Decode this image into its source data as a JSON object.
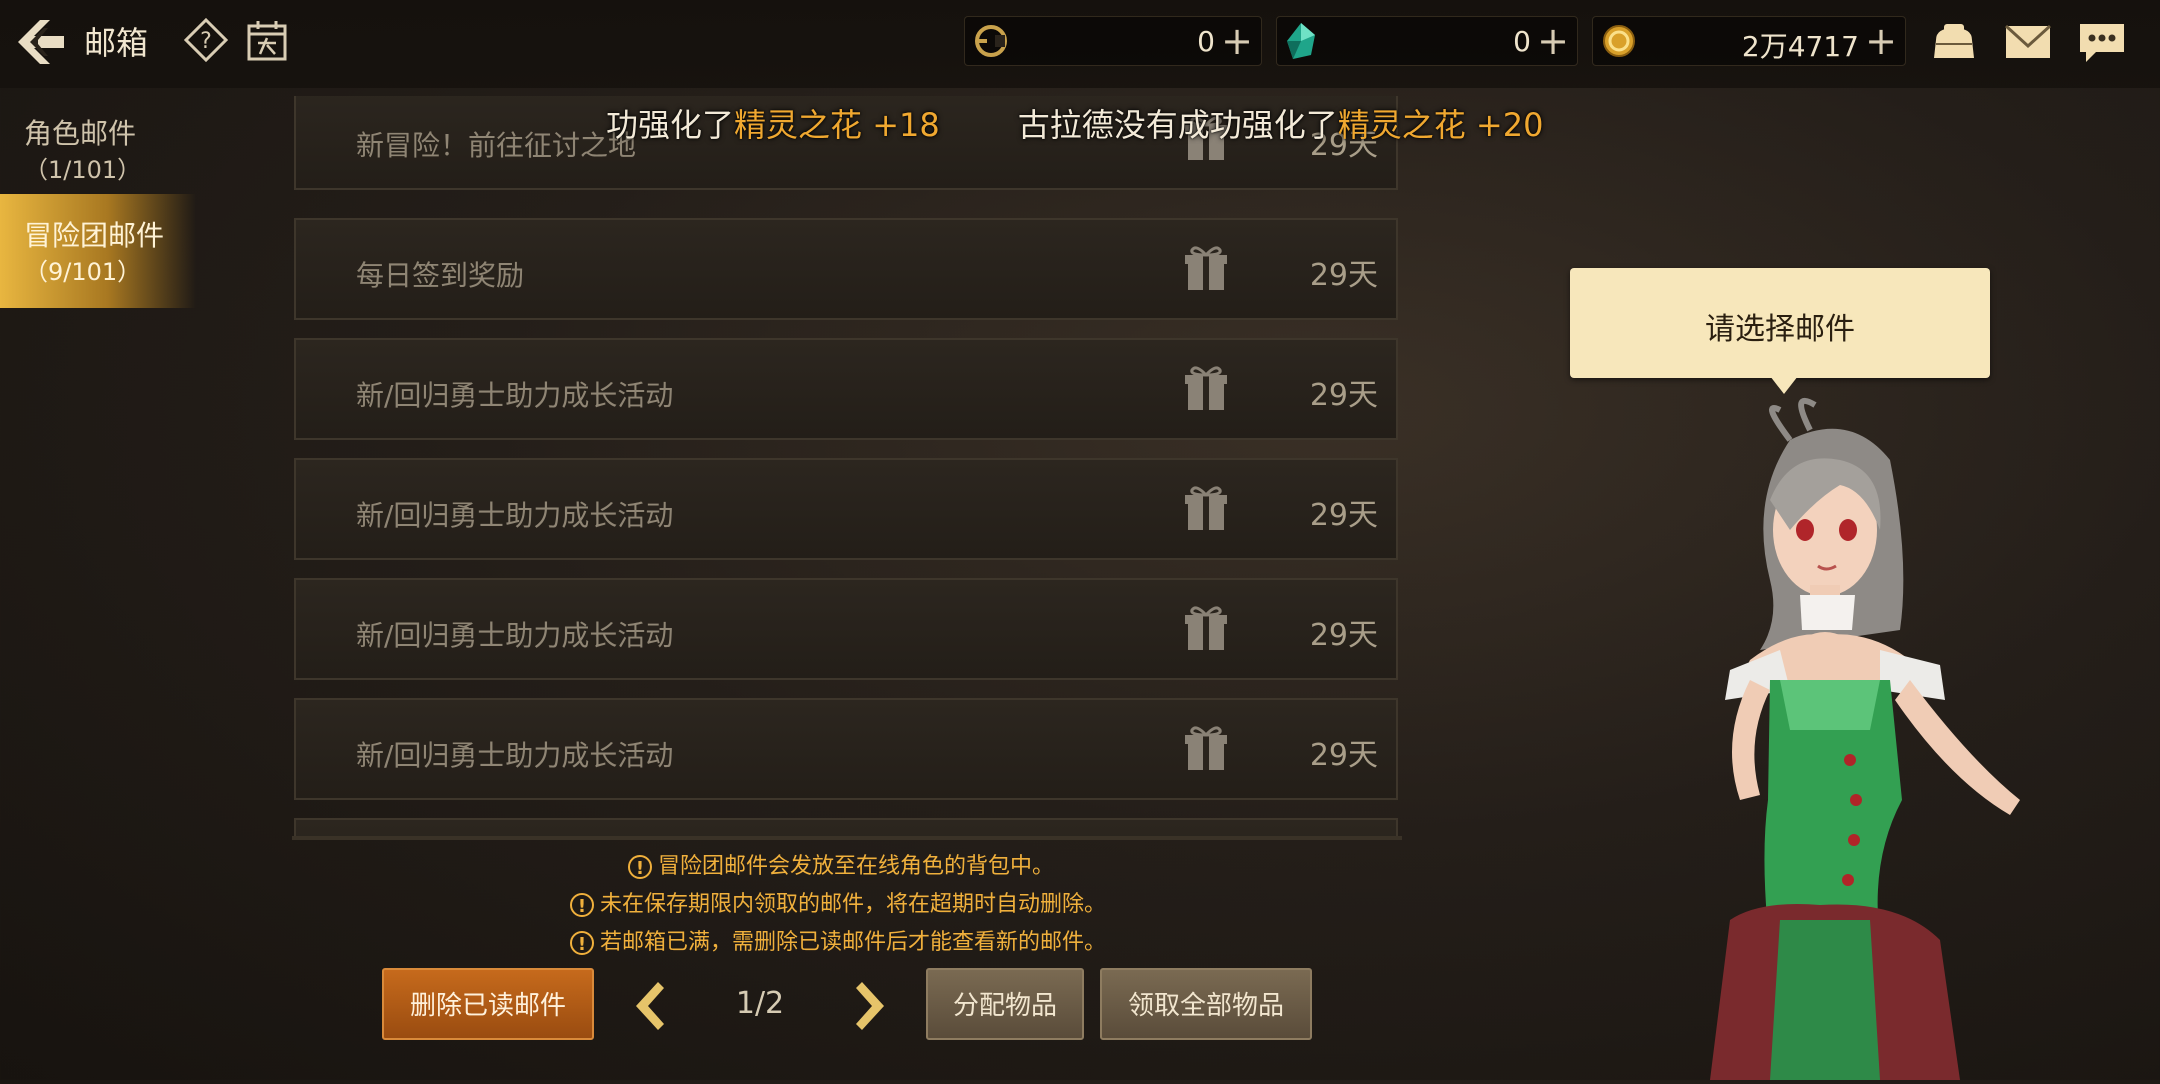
{
  "header": {
    "title": "邮箱",
    "currencies": [
      {
        "icon": "cera-coin-icon",
        "value": "0"
      },
      {
        "icon": "green-gem-icon",
        "value": "0"
      },
      {
        "icon": "gold-coin-icon",
        "value": "2万4717"
      }
    ],
    "plus_label": "+"
  },
  "tabs": [
    {
      "label": "角色邮件",
      "count": "（1/101）"
    },
    {
      "label": "冒险团邮件",
      "count": "（9/101）"
    }
  ],
  "ticker": {
    "msg1_prefix": "功强化了",
    "msg1_item": "精灵之花 +18",
    "msg2_prefix": "古拉德没有成功强化了",
    "msg2_item": "精灵之花 +20"
  },
  "mail_items": [
    {
      "title": "新冒险！前往征讨之地",
      "days": "29天"
    },
    {
      "title": "每日签到奖励",
      "days": "29天"
    },
    {
      "title": "新/回归勇士助力成长活动",
      "days": "29天"
    },
    {
      "title": "新/回归勇士助力成长活动",
      "days": "29天"
    },
    {
      "title": "新/回归勇士助力成长活动",
      "days": "29天"
    },
    {
      "title": "新/回归勇士助力成长活动",
      "days": "29天"
    }
  ],
  "notices": [
    "冒险团邮件会发放至在线角色的背包中。",
    "未在保存期限内领取的邮件，将在超期时自动删除。",
    "若邮箱已满，需删除已读邮件后才能查看新的邮件。"
  ],
  "notice_mark": "!",
  "buttons": {
    "delete_read": "删除已读邮件",
    "assign": "分配物品",
    "claim_all": "领取全部物品"
  },
  "pagination": {
    "current": "1/2"
  },
  "bubble": {
    "text": "请选择邮件"
  },
  "colors": {
    "accent": "#f0a830",
    "tab_active": "#e8b640",
    "button_orange": "#c66a1c"
  }
}
